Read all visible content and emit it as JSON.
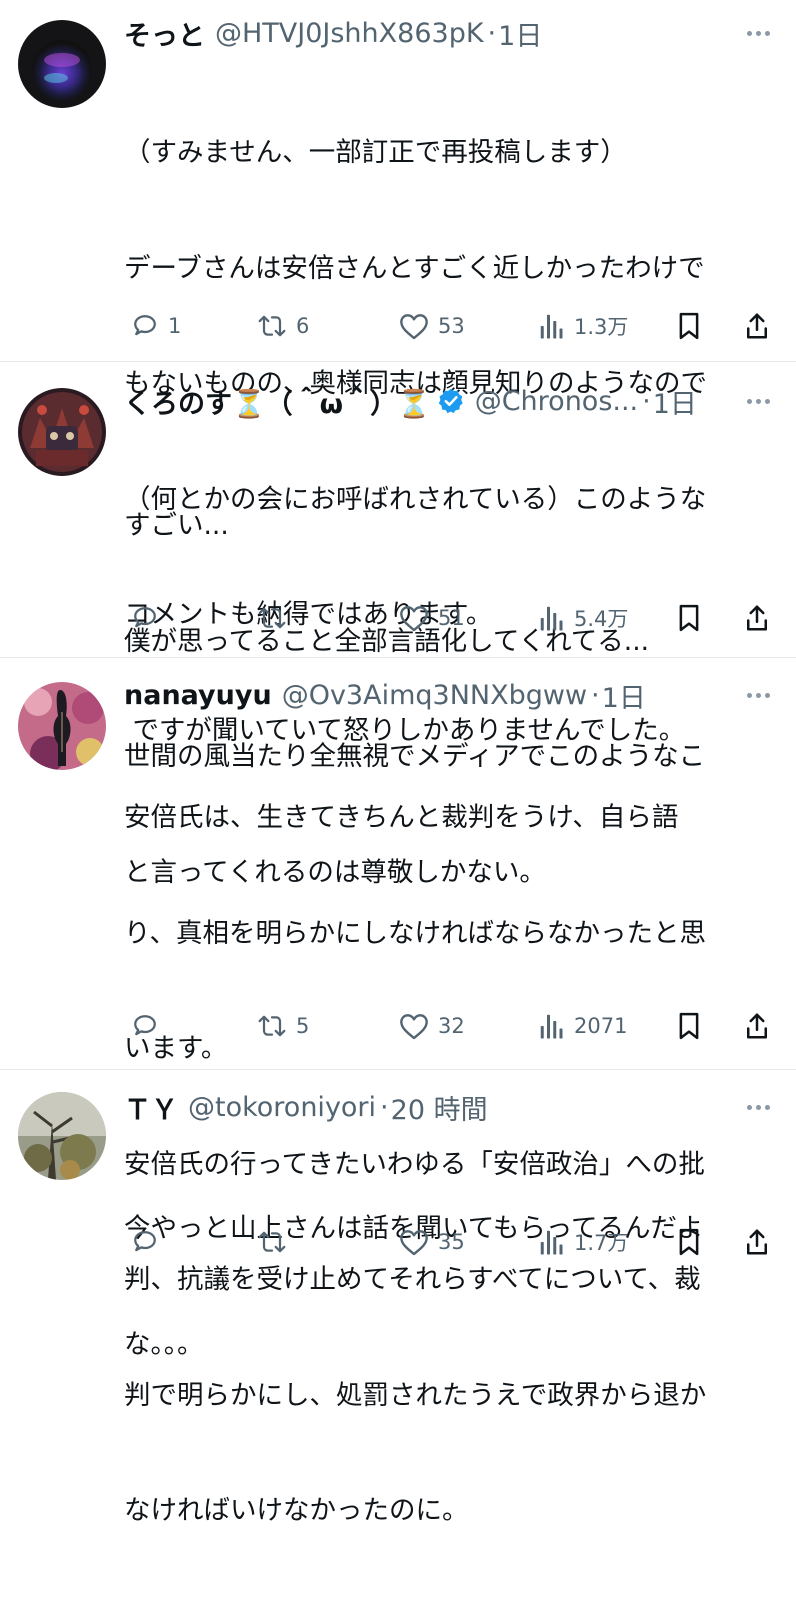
{
  "tweets": [
    {
      "name": "そっと",
      "handle": "@HTVJ0JshhX863pK",
      "separator": "·",
      "time": "1日",
      "verified": false,
      "text_lines": [
        "（すみません、一部訂正で再投稿します）",
        "デーブさんは安倍さんとすごく近しかったわけで",
        "もないものの、奥様同志は顔見知りのようなので",
        "（何とかの会にお呼ばれされている）このような",
        "コメントも納得ではあります。",
        " ですが聞いていて怒りしかありませんでした。"
      ],
      "replies": "1",
      "retweets": "6",
      "likes": "53",
      "views": "1.3万"
    },
    {
      "name": "くろのす⏳（＾ω＾）⏳",
      "handle": "@Chronos...",
      "separator": "·",
      "time": "1日",
      "verified": true,
      "text_lines": [
        "すごい...",
        "僕が思ってること全部言語化してくれてる...",
        "世間の風当たり全無視でメディアでこのようなこ",
        "と言ってくれるのは尊敬しかない。"
      ],
      "replies": "",
      "retweets": "",
      "likes": "51",
      "views": "5.4万"
    },
    {
      "name": "nanayuyu",
      "handle": "@Ov3Aimq3NNXbgww",
      "separator": "·",
      "time": "1日",
      "verified": false,
      "text_lines": [
        "安倍氏は、生きてきちんと裁判をうけ、自ら語",
        "り、真相を明らかにしなければならなかったと思",
        "います。",
        "安倍氏の行ってきたいわゆる「安倍政治」への批",
        "判、抗議を受け止めてそれらすべてについて、裁",
        "判で明らかにし、処罰されたうえで政界から退か",
        "なければいけなかったのに。"
      ],
      "replies": "",
      "retweets": "5",
      "likes": "32",
      "views": "2071"
    },
    {
      "name": "ＴＹ",
      "handle": "@tokoroniyori",
      "separator": "·",
      "time": "20 時間",
      "verified": false,
      "text_lines": [
        "今やっと山上さんは話を聞いてもらってるんだよ",
        "な。。。"
      ],
      "replies": "",
      "retweets": "",
      "likes": "35",
      "views": "1.7万"
    }
  ],
  "icons": {
    "reply": "reply-icon",
    "retweet": "retweet-icon",
    "like": "heart-icon",
    "views": "views-icon",
    "bookmark": "bookmark-icon",
    "share": "share-icon",
    "more": "more-icon",
    "verified": "verified-badge-icon"
  },
  "colors": {
    "text": "#0f1419",
    "secondary": "#536471",
    "verified": "#1d9bf0",
    "divider": "#e6e9eb"
  }
}
